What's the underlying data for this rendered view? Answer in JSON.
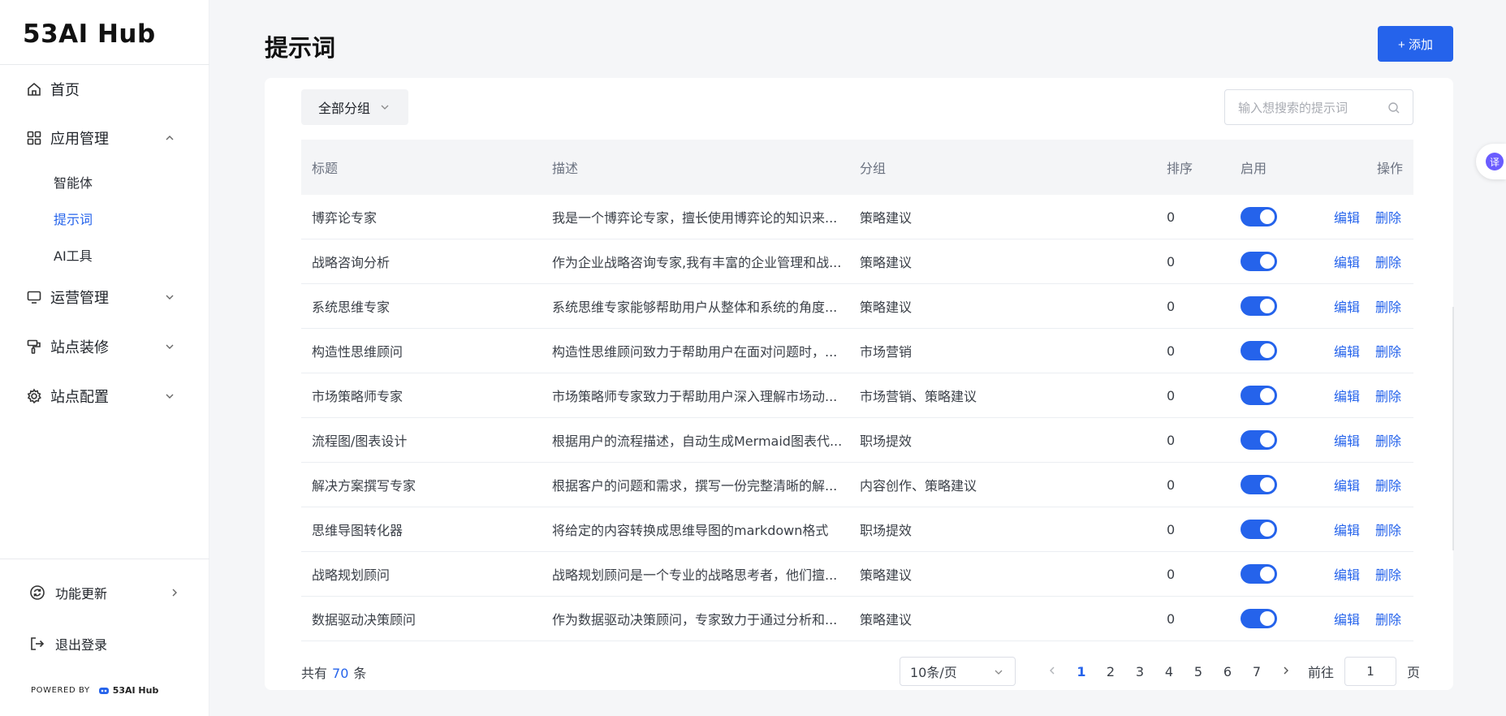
{
  "sidebar": {
    "logo": "53AI Hub",
    "items": [
      {
        "label": "首页",
        "icon": "home-icon"
      },
      {
        "label": "应用管理",
        "icon": "apps-grid-icon",
        "expanded": true,
        "children": [
          {
            "label": "智能体"
          },
          {
            "label": "提示词",
            "active": true
          },
          {
            "label": "AI工具"
          }
        ]
      },
      {
        "label": "运营管理",
        "icon": "monitor-icon"
      },
      {
        "label": "站点装修",
        "icon": "paint-roller-icon"
      },
      {
        "label": "站点配置",
        "icon": "gear-icon"
      }
    ],
    "bottom": [
      {
        "label": "功能更新",
        "icon": "refresh-icon"
      },
      {
        "label": "退出登录",
        "icon": "logout-icon"
      }
    ],
    "powered_by": "POWERED BY",
    "powered_brand": "53AI Hub"
  },
  "header": {
    "title": "提示词",
    "add_label": "+ 添加"
  },
  "filters": {
    "group_select": "全部分组",
    "search_placeholder": "输入想搜索的提示词"
  },
  "table": {
    "columns": {
      "title": "标题",
      "desc": "描述",
      "group": "分组",
      "order": "排序",
      "enable": "启用",
      "op": "操作"
    },
    "edit_label": "编辑",
    "delete_label": "删除",
    "rows": [
      {
        "title": "博弈论专家",
        "desc": "我是一个博弈论专家，擅长使用博弈论的知识来...",
        "group": "策略建议",
        "order": "0",
        "enabled": true
      },
      {
        "title": "战略咨询分析",
        "desc": "作为企业战略咨询专家,我有丰富的企业管理和战...",
        "group": "策略建议",
        "order": "0",
        "enabled": true
      },
      {
        "title": "系统思维专家",
        "desc": "系统思维专家能够帮助用户从整体和系统的角度...",
        "group": "策略建议",
        "order": "0",
        "enabled": true
      },
      {
        "title": "构造性思维顾问",
        "desc": "构造性思维顾问致力于帮助用户在面对问题时，...",
        "group": "市场营销",
        "order": "0",
        "enabled": true
      },
      {
        "title": "市场策略师专家",
        "desc": "市场策略师专家致力于帮助用户深入理解市场动...",
        "group": "市场营销、策略建议",
        "order": "0",
        "enabled": true
      },
      {
        "title": "流程图/图表设计",
        "desc": "根据用户的流程描述，自动生成Mermaid图表代...",
        "group": "职场提效",
        "order": "0",
        "enabled": true
      },
      {
        "title": "解决方案撰写专家",
        "desc": "根据客户的问题和需求，撰写一份完整清晰的解...",
        "group": "内容创作、策略建议",
        "order": "0",
        "enabled": true
      },
      {
        "title": "思维导图转化器",
        "desc": "将给定的内容转换成思维导图的markdown格式",
        "group": "职场提效",
        "order": "0",
        "enabled": true
      },
      {
        "title": "战略规划顾问",
        "desc": "战略规划顾问是一个专业的战略思考者，他们擅...",
        "group": "策略建议",
        "order": "0",
        "enabled": true
      },
      {
        "title": "数据驱动决策顾问",
        "desc": "作为数据驱动决策顾问，专家致力于通过分析和...",
        "group": "策略建议",
        "order": "0",
        "enabled": true
      }
    ]
  },
  "pagination": {
    "total_prefix": "共有",
    "total": "70",
    "total_suffix": "条",
    "page_size": "10条/页",
    "pages": [
      "1",
      "2",
      "3",
      "4",
      "5",
      "6",
      "7"
    ],
    "current": "1",
    "goto_prefix": "前往",
    "goto_value": "1",
    "goto_suffix": "页"
  },
  "translate_tab": "译",
  "colors": {
    "accent": "#2563eb",
    "translate": "#6a5cff"
  }
}
